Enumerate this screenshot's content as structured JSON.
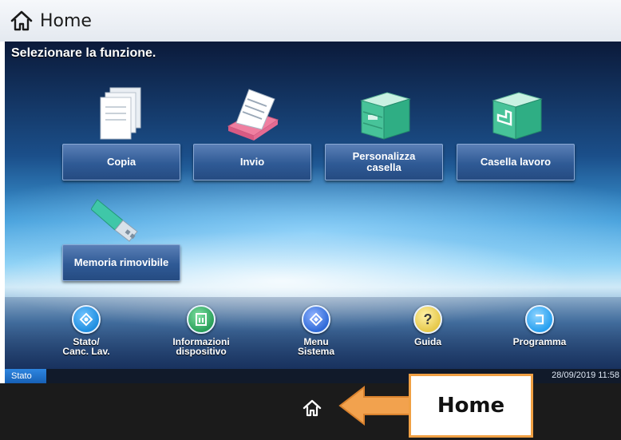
{
  "titlebar": {
    "title": "Home",
    "icon": "home-icon"
  },
  "screen": {
    "prompt": "Selezionare la funzione.",
    "apps": [
      {
        "label": "Copia",
        "icon": "copy-icon"
      },
      {
        "label": "Invio",
        "icon": "send-icon"
      },
      {
        "label": "Personalizza\ncasella",
        "icon": "custom-box-icon"
      },
      {
        "label": "Casella lavoro",
        "icon": "job-box-icon"
      },
      {
        "label": "Memoria rimovibile",
        "icon": "usb-memory-icon"
      }
    ]
  },
  "funcbar": [
    {
      "label": "Stato/\nCanc. Lav.",
      "icon": "status-icon",
      "color": "#1f8ee0"
    },
    {
      "label": "Informazioni\ndispositivo",
      "icon": "device-info-icon",
      "color": "#2aa05a"
    },
    {
      "label": "Menu\nSistema",
      "icon": "system-menu-icon",
      "color": "#2f6ad8"
    },
    {
      "label": "Guida",
      "icon": "help-icon",
      "glyph": "?",
      "color": "#e6c84a"
    },
    {
      "label": "Programma",
      "icon": "program-icon",
      "color": "#27a0f0"
    }
  ],
  "statusbar": {
    "tab": "Stato",
    "datetime": "28/09/2019  11:58"
  },
  "callout": {
    "label": "Home"
  }
}
